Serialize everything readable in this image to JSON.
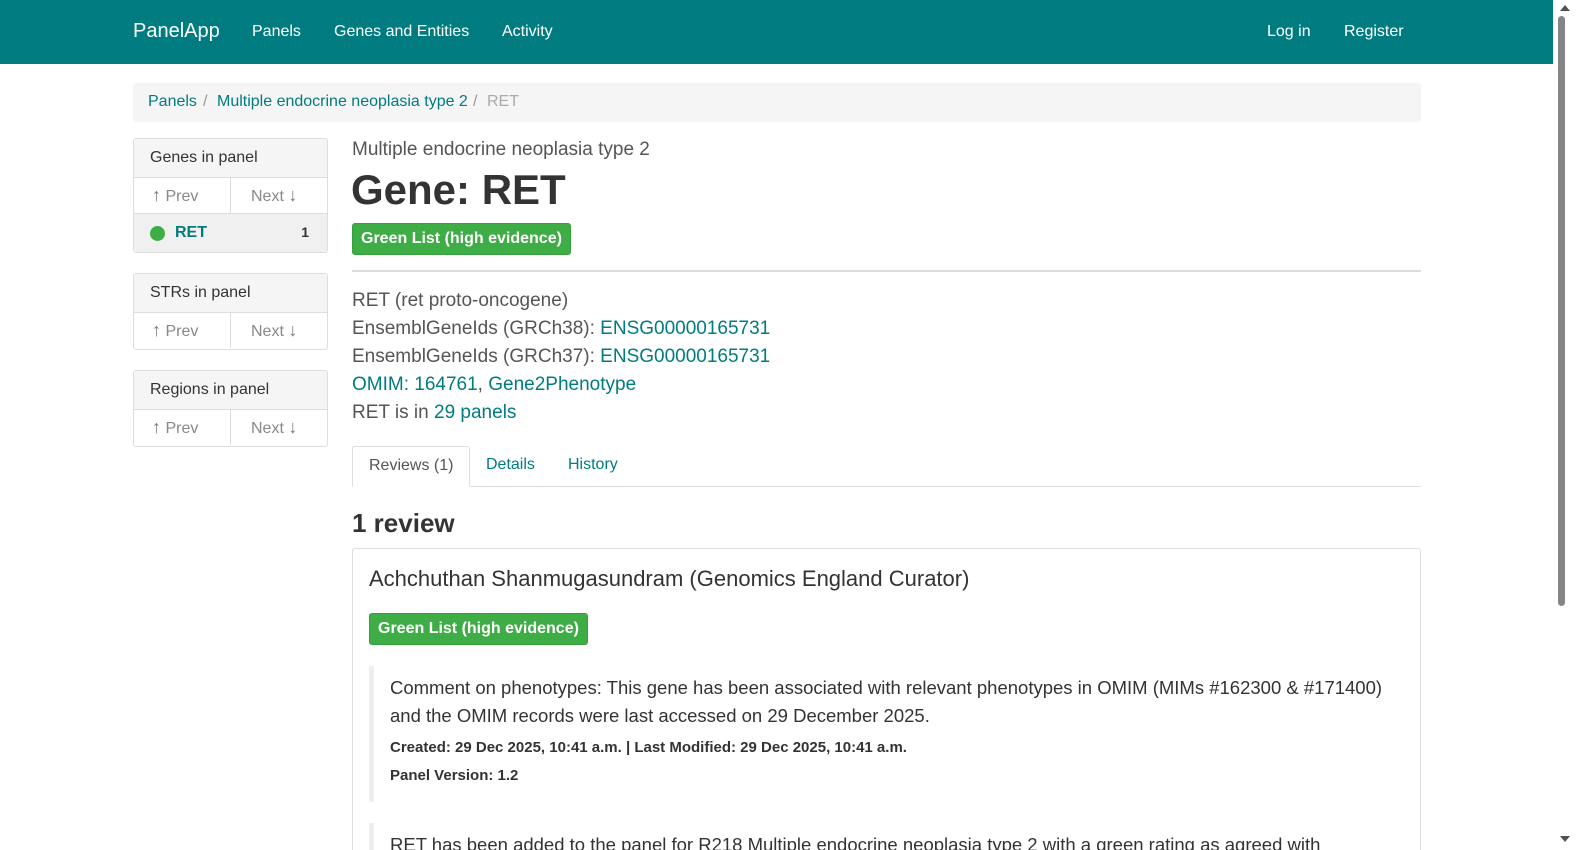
{
  "nav": {
    "brand": "PanelApp",
    "links": [
      "Panels",
      "Genes and Entities",
      "Activity"
    ],
    "login": "Log in",
    "register": "Register"
  },
  "breadcrumb": {
    "panels": "Panels",
    "sep": "/",
    "panel": "Multiple endocrine neoplasia type 2",
    "current": "RET"
  },
  "sidebar": {
    "genes": {
      "title": "Genes in panel",
      "prev": "Prev",
      "next": "Next",
      "gene": "RET",
      "count": "1"
    },
    "strs": {
      "title": "STRs in panel",
      "prev": "Prev",
      "next": "Next"
    },
    "regions": {
      "title": "Regions in panel",
      "prev": "Prev",
      "next": "Next"
    }
  },
  "icons": {
    "up": "↑",
    "down": "↓"
  },
  "header": {
    "panel_name": "Multiple endocrine neoplasia type 2",
    "title": "Gene: RET",
    "rating": "Green List (high evidence)"
  },
  "gene_info": {
    "symbol_line": "RET (ret proto-oncogene)",
    "ensembl38_label": "EnsemblGeneIds (GRCh38): ",
    "ensembl38_value": "ENSG00000165731",
    "ensembl37_label": "EnsemblGeneIds (GRCh37): ",
    "ensembl37_value": "ENSG00000165731",
    "omim": "OMIM: 164761",
    "comma": ", ",
    "g2p": "Gene2Phenotype",
    "panels_prefix": "RET is in ",
    "panels_link": "29 panels"
  },
  "tabs": [
    "Reviews (1)",
    "Details",
    "History"
  ],
  "reviews": {
    "count_heading": "1 review",
    "reviewer": "Achchuthan Shanmugasundram (Genomics England Curator)",
    "rating": "Green List (high evidence)",
    "comment1": "Comment on phenotypes: This gene has been associated with relevant phenotypes in OMIM (MIMs #162300 & #171400) and the OMIM records were last accessed on 29 December 2025.",
    "meta1": "Created: 29 Dec 2025, 10:41 a.m. | Last Modified: 29 Dec 2025, 10:41 a.m.",
    "version1": "Panel Version: 1.2",
    "comment2": "RET has been added to the panel for R218 Multiple endocrine neoplasia type 2 with a green rating as agreed with"
  },
  "colors": {
    "brand": "#007c80",
    "green": "#3fad46"
  }
}
